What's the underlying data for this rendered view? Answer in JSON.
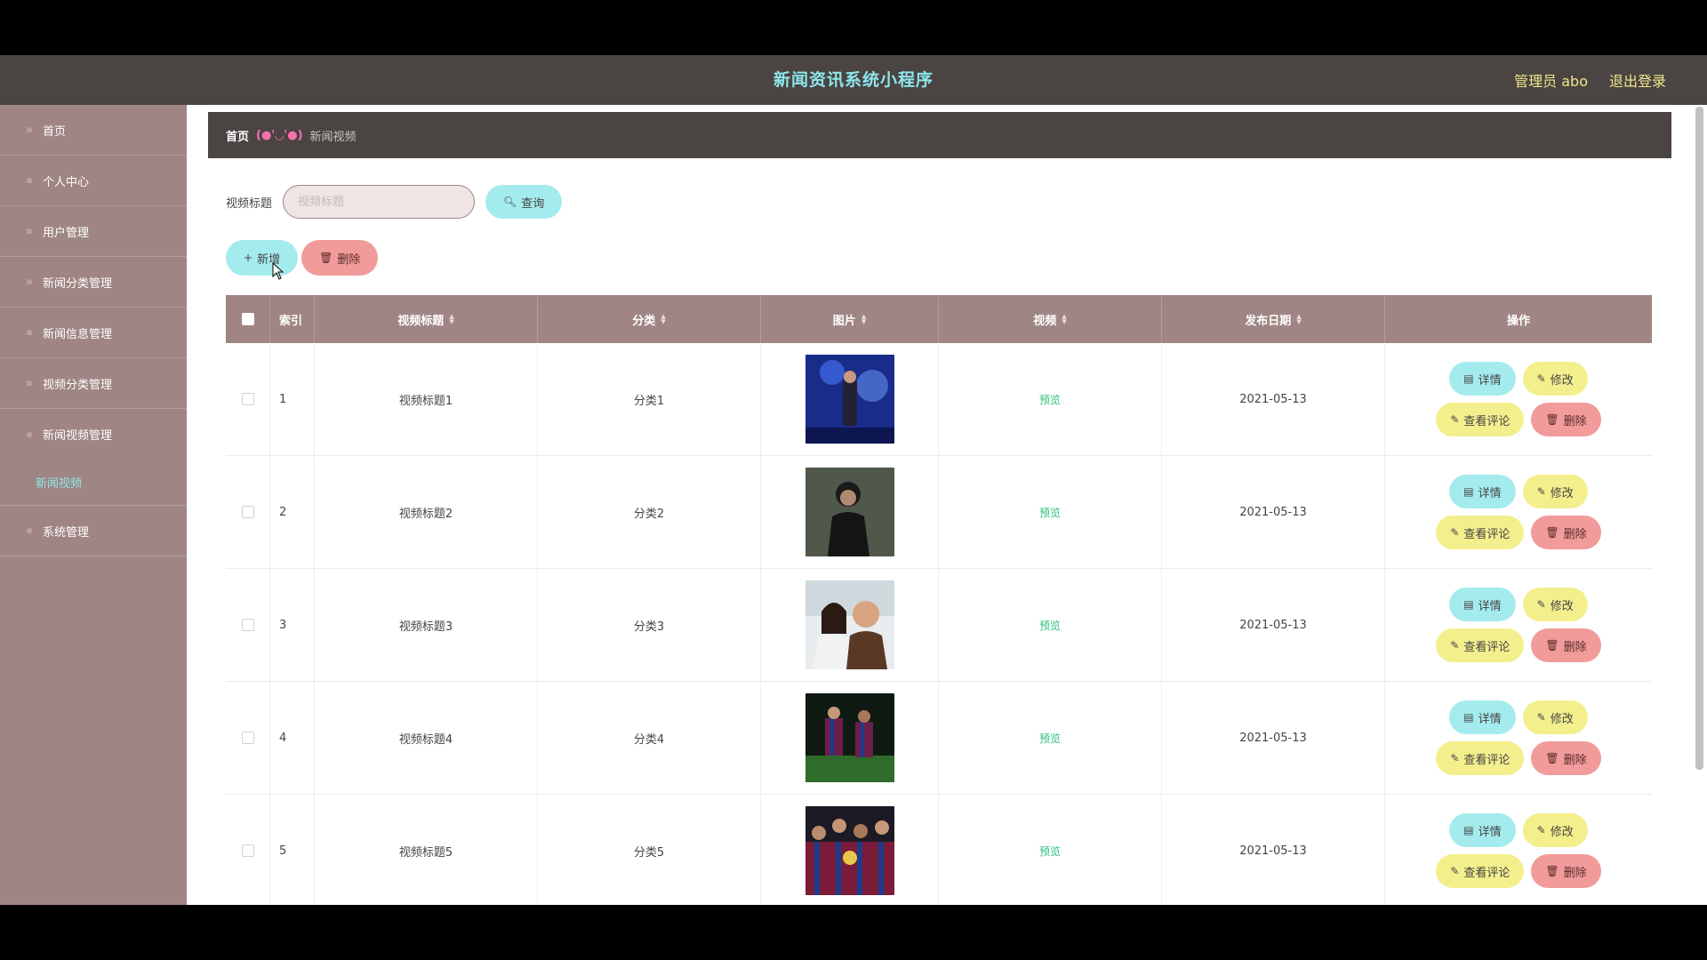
{
  "header": {
    "title": "新闻资讯系统小程序",
    "admin_label": "管理员 abo",
    "logout": "退出登录"
  },
  "sidebar": {
    "items": [
      {
        "label": "首页"
      },
      {
        "label": "个人中心"
      },
      {
        "label": "用户管理"
      },
      {
        "label": "新闻分类管理"
      },
      {
        "label": "新闻信息管理"
      },
      {
        "label": "视频分类管理"
      },
      {
        "label": "新闻视频管理"
      }
    ],
    "sub_item": "新闻视频",
    "last_item": "系统管理"
  },
  "breadcrumb": {
    "home": "首页",
    "separator": "(●'◡'●)",
    "current": "新闻视频"
  },
  "search": {
    "label": "视频标题",
    "placeholder": "视频标题",
    "button": "查询"
  },
  "actions": {
    "add": "新增",
    "delete": "删除"
  },
  "table": {
    "columns": {
      "index": "索引",
      "title": "视频标题",
      "category": "分类",
      "image": "图片",
      "video": "视频",
      "date": "发布日期",
      "ops": "操作"
    },
    "rows": [
      {
        "index": "1",
        "title": "视频标题1",
        "category": "分类1",
        "video": "预览",
        "date": "2021-05-13"
      },
      {
        "index": "2",
        "title": "视频标题2",
        "category": "分类2",
        "video": "预览",
        "date": "2021-05-13"
      },
      {
        "index": "3",
        "title": "视频标题3",
        "category": "分类3",
        "video": "预览",
        "date": "2021-05-13"
      },
      {
        "index": "4",
        "title": "视频标题4",
        "category": "分类4",
        "video": "预览",
        "date": "2021-05-13"
      },
      {
        "index": "5",
        "title": "视频标题5",
        "category": "分类5",
        "video": "预览",
        "date": "2021-05-13"
      }
    ],
    "ops": {
      "detail": "详情",
      "edit": "修改",
      "comments": "查看评论",
      "delete": "删除"
    }
  },
  "colors": {
    "header_bg": "#4a4443",
    "sidebar_bg": "#9f8583",
    "accent_cyan": "#a4ebed",
    "accent_red": "#f19b9a",
    "accent_yellow": "#f3ef8c",
    "title_cyan": "#8ee6ea",
    "preview_green": "#2bbf7a"
  }
}
